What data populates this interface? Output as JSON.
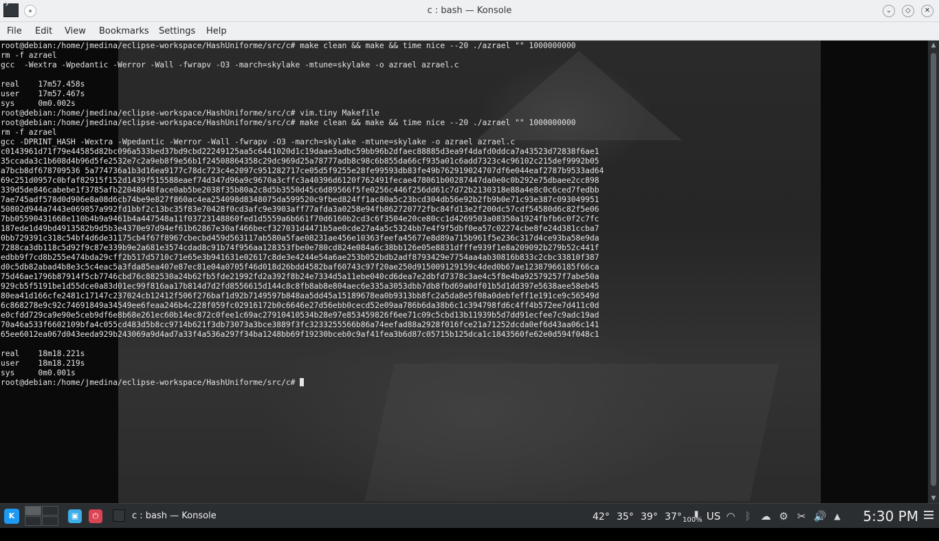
{
  "window": {
    "title": "c : bash — Konsole",
    "controls": {
      "minimize": "⌄",
      "maximize": "◇",
      "close": "✕"
    }
  },
  "menu": [
    "File",
    "Edit",
    "View",
    "Bookmarks",
    "Settings",
    "Help"
  ],
  "terminal": {
    "lines": [
      "root@debian:/home/jmedina/eclipse-workspace/HashUniforme/src/c# make clean && make && time nice --20 ./azrael \"\" 1000000000",
      "rm -f azrael",
      "gcc  -Wextra -Wpedantic -Werror -Wall -fwrapv -O3 -march=skylake -mtune=skylake -o azrael azrael.c",
      "",
      "real    17m57.458s",
      "user    17m57.467s",
      "sys     0m0.002s",
      "root@debian:/home/jmedina/eclipse-workspace/HashUniforme/src/c# vim.tiny Makefile",
      "root@debian:/home/jmedina/eclipse-workspace/HashUniforme/src/c# make clean && make && time nice --20 ./azrael \"\" 1000000000",
      "rm -f azrael",
      "gcc -DPRINT_HASH -Wextra -Wpedantic -Werror -Wall -fwrapv -O3 -march=skylake -mtune=skylake -o azrael azrael.c",
      "c0143961d71f79e44585d82bc096a533bed37bd9cbd22249125aa5c6441020d1c19daae3adbc59bb96b2dfaec88885d3ea9f4dafd0ddca7a43523d72838f6ae1",
      "35ccada3c1b608d4b96d5fe2532e7c2a9eb8f9e56b1f24508864358c29dc969d25a78777adb8c98c6b855da66cf935a01c6add7323c4c96102c215def9992b05",
      "a7bcb8df678709536 5a774736a1b3d16ea9177c78dc723c4e2097c951282717ce05d5f9255e28fe99593db83fe49b762919024707df6e044eaf2787b9533ad64",
      "69c251d0957c0bfaf82915f152d1439f515588eaef74d347d96a9c9670a3cffc3a40396d6120f762491fecae478061b00287447da0e0c0b292e75dbaee2cc898",
      "339d5de846cabebe1f3785afb22048d48face0ab5be2038f35b80a2c8d5b3550d45c6d89566f5fe0256c446f256dd61c7d72b2130318e88a4e8c0c6ced7fedbb",
      "7ae745adf578d0d906e8a08d6cb74be9e827f860ac4ea254098d8348075da599520c9fbed824ff1ac80a5c23bcd304db56e92b2fb9b0e71c93e387c093049951",
      "50802d944a7443e069857a992fd1bbf2c13bc35f83e70428f0cd3afc9e3903aff77afda3a0258e94fb862720772fbc84fd13e2f200dc57cdf54580d6c82f5e06",
      "7bb05590431668e110b4b9a9461b4a447548a11f03723148860fed1d5559a6b661f70d6160b2cd3c6f3504e20ce80cc1d4269503a08350a1924fbfb6c0f2c7fc",
      "187ede1d49bd4913582b9d5b3e4370e97d94ef61b62867e30af466becf327031d4471b5ae0cde27a4a5c5324bb7e4f9f5dbf0ea57c02274cbe8fe24d381ccba7",
      "0bb729391c318c54bf4d6de31175cb4f67f8967cbecbd459d563117ab580a5fae08231ae456e10363feefa45677e8d89a715b961f5e236c317d4ce93ba58e9da",
      "7288ca3db118c5d92f9c87e339b9e2a681e3574cdad8c91b74f956aa128353fbe0e780cd824e084a6c38bb126e05e8831dfffe939f1e8a209092b279b52c441f",
      "edbb9f7cd8b255e474bda29cff2b517d5710c71e65e3b941631e02617c8de3e4244e54a6ae253b052bdb2adf8793429e7754aa4ab30816b833c2cbc33810f387",
      "d0c5db82abad4b8e3c5c4eac5a3fda85ea407e87ec81e04a0705f46d018d26bdd4582baf60743c97f20ae250d915009129159c4ded0b67ae12387966185f66ca",
      "75d46ae1796b87914f5cb7746cbd76c882530a24b62fb5fde21992fd2a392f8b24e7334d5a11ebe040cd6dea7e2dbfd7378c3ae4c5f8e4ba92579257f7abe50a",
      "929cb5f5191be1d55dce0a83d01ec99f816aa17b814d7d2fd8556615d144c8c8fb8ab8e804aec6e335a3053dbb7db8fbd69a0df01b5d1dd397e5638aee58eb45",
      "80ea41d166cfe2481c17147c237024cb12412f506f276baf1d92b7149597b848aa5dd45a15189678ea0b9313bb8fc2a5da8e5f08a0debfeff1e191ce9c56549d",
      "6c868278e9c92c74691849a34549ee6feaa246b4c228f059fc02916172b0c6646e27d56ebb0cecd52e09aa786b6da38b6c1c394798fd6c4ff4b572ee7d411c0d",
      "e0cfdd729ca9e90e5ceb9df6e8b68e261ec60b14ec872c0fee1c69ac27910410534b28e97e853459826f6ee71c09c5cbd13b11939b5d7dd91ecfee7c9adc19ad",
      "70a46a533f6602109bfa4c055cd483d5b8cc9714b621f3db73073a3bce3889f3fc3233255566b86a74eefad88a2928f016fce21a71252dcda0ef6d43aa06c141",
      "65ee6012ea067d043eeda929b243069a9d4ad7a33f4a536a297f34ba1248bb69f19230bceb0c9af41fea3b6d87c05715b125dca1c1843560fe62e0d594f048c1",
      "",
      "real    18m18.221s",
      "user    18m18.219s",
      "sys     0m0.001s",
      "root@debian:/home/jmedina/eclipse-workspace/HashUniforme/src/c# "
    ]
  },
  "taskbar": {
    "task_label": "c : bash — Konsole",
    "temperatures": [
      "42°",
      "35°",
      "39°",
      "37°"
    ],
    "battery_percent": "100%",
    "keyboard_layout": "US",
    "clock": "5:30 PM",
    "colors": {
      "accent": "#1d99f3",
      "panel": "#2b2e31",
      "power": "#da4453"
    }
  }
}
